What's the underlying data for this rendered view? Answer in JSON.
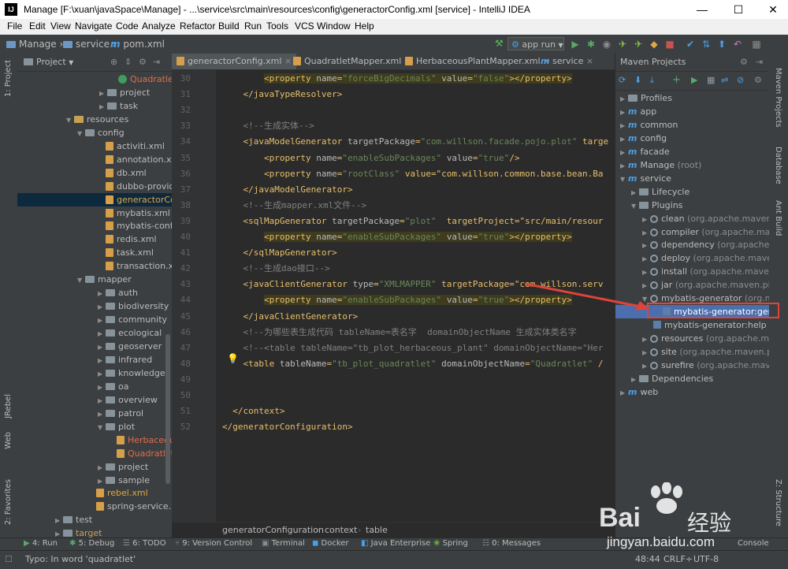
{
  "window": {
    "title": "Manage [F:\\xuan\\javaSpace\\Manage] - ...\\service\\src\\main\\resources\\config\\generactorConfig.xml [service] - IntelliJ IDEA",
    "app_logo": "IJ",
    "minimize": "—",
    "maximize": "☐",
    "close": "✕"
  },
  "menu": [
    "File",
    "Edit",
    "View",
    "Navigate",
    "Code",
    "Analyze",
    "Refactor",
    "Build",
    "Run",
    "Tools",
    "VCS",
    "Window",
    "Help"
  ],
  "breadcrumbs": [
    "Manage",
    "service",
    "pom.xml"
  ],
  "run_config": "app run",
  "left_tools": [
    "1: Project",
    "JRebel",
    "Web",
    "2: Favorites"
  ],
  "project_panel": {
    "title": "Project",
    "rows": [
      {
        "label": "QuadratletM",
        "kind": "class"
      },
      {
        "label": "project",
        "kind": "folder"
      },
      {
        "label": "task",
        "kind": "folder"
      },
      {
        "label": "resources",
        "kind": "folder"
      },
      {
        "label": "config",
        "kind": "folder"
      },
      {
        "label": "activiti.xml",
        "kind": "xml"
      },
      {
        "label": "annotation.xml",
        "kind": "xml"
      },
      {
        "label": "db.xml",
        "kind": "xml"
      },
      {
        "label": "dubbo-provider",
        "kind": "xml"
      },
      {
        "label": "generactorConfi",
        "kind": "xml"
      },
      {
        "label": "mybatis.xml",
        "kind": "xml"
      },
      {
        "label": "mybatis-config.x",
        "kind": "xml"
      },
      {
        "label": "redis.xml",
        "kind": "xml"
      },
      {
        "label": "task.xml",
        "kind": "xml"
      },
      {
        "label": "transaction.xml",
        "kind": "xml"
      },
      {
        "label": "mapper",
        "kind": "folder"
      },
      {
        "label": "auth",
        "kind": "folder"
      },
      {
        "label": "biodiversity",
        "kind": "folder"
      },
      {
        "label": "community",
        "kind": "folder"
      },
      {
        "label": "ecological",
        "kind": "folder"
      },
      {
        "label": "geoserver",
        "kind": "folder"
      },
      {
        "label": "infrared",
        "kind": "folder"
      },
      {
        "label": "knowledge",
        "kind": "folder"
      },
      {
        "label": "oa",
        "kind": "folder"
      },
      {
        "label": "overview",
        "kind": "folder"
      },
      {
        "label": "patrol",
        "kind": "folder"
      },
      {
        "label": "plot",
        "kind": "folder"
      },
      {
        "label": "HerbaceousP",
        "kind": "xml"
      },
      {
        "label": "QuadratletM",
        "kind": "xml"
      },
      {
        "label": "project",
        "kind": "folder"
      },
      {
        "label": "sample",
        "kind": "folder"
      },
      {
        "label": "rebel.xml",
        "kind": "xml"
      },
      {
        "label": "spring-service.xml",
        "kind": "xml"
      },
      {
        "label": "test",
        "kind": "folder"
      },
      {
        "label": "target",
        "kind": "folder"
      }
    ]
  },
  "editor": {
    "tabs": [
      "generactorConfig.xml",
      "QuadratletMapper.xml",
      "HerbaceousPlantMapper.xml",
      "service"
    ],
    "lines": [
      {
        "n": "30",
        "text": "        <property name=\"forceBigDecimals\" value=\"false\"></property>",
        "hl": true
      },
      {
        "n": "31",
        "text": "    </javaTypeResolver>"
      },
      {
        "n": "32",
        "text": ""
      },
      {
        "n": "33",
        "text": "    <!--生成实体-->",
        "comment": true
      },
      {
        "n": "34",
        "text": "    <javaModelGenerator targetPackage=\"com.willson.facade.pojo.plot\" targe"
      },
      {
        "n": "35",
        "text": "        <property name=\"enableSubPackages\" value=\"true\"/>"
      },
      {
        "n": "36",
        "text": "        <property name=\"rootClass\" value=\"com.willson.common.base.bean.Ba"
      },
      {
        "n": "37",
        "text": "    </javaModelGenerator>"
      },
      {
        "n": "38",
        "text": "    <!--生成mapper.xml文件-->",
        "comment": true
      },
      {
        "n": "39",
        "text": "    <sqlMapGenerator targetPackage=\"plot\"  targetProject=\"src/main/resour"
      },
      {
        "n": "40",
        "text": "        <property name=\"enableSubPackages\" value=\"true\"></property>",
        "hl": true
      },
      {
        "n": "41",
        "text": "    </sqlMapGenerator>"
      },
      {
        "n": "42",
        "text": "    <!--生成dao接口-->",
        "comment": true
      },
      {
        "n": "43",
        "text": "    <javaClientGenerator type=\"XMLMAPPER\" targetPackage=\"com.willson.serv"
      },
      {
        "n": "44",
        "text": "        <property name=\"enableSubPackages\" value=\"true\"></property>",
        "hl": true
      },
      {
        "n": "45",
        "text": "    </javaClientGenerator>"
      },
      {
        "n": "46",
        "text": "    <!--为哪些表生成代码 tableName=表名字  domainObjectName 生成实体类名字",
        "comment": true
      },
      {
        "n": "47",
        "text": "    <!--<table tableName=\"tb_plot_herbaceous_plant\" domainObjectName=\"Her",
        "comment": true
      },
      {
        "n": "48",
        "text": "    <table tableName=\"tb_plot_quadratlet\" domainObjectName=\"Quadratlet\" /"
      },
      {
        "n": "49",
        "text": ""
      },
      {
        "n": "50",
        "text": ""
      },
      {
        "n": "51",
        "text": "  </context>"
      },
      {
        "n": "52",
        "text": "</generatorConfiguration>"
      }
    ],
    "crumbs": [
      "generatorConfiguration",
      "context",
      "table"
    ]
  },
  "maven": {
    "title": "Maven Projects",
    "rows": [
      {
        "label": "Profiles",
        "depth": 0,
        "kind": "folder"
      },
      {
        "label": "app",
        "depth": 0,
        "kind": "module"
      },
      {
        "label": "common",
        "depth": 0,
        "kind": "module"
      },
      {
        "label": "config",
        "depth": 0,
        "kind": "module"
      },
      {
        "label": "facade",
        "depth": 0,
        "kind": "module"
      },
      {
        "label": "Manage",
        "suffix": "(root)",
        "depth": 0,
        "kind": "module"
      },
      {
        "label": "service",
        "depth": 0,
        "kind": "module"
      },
      {
        "label": "Lifecycle",
        "depth": 1,
        "kind": "folder"
      },
      {
        "label": "Plugins",
        "depth": 1,
        "kind": "folder"
      },
      {
        "label": "clean",
        "suffix": "(org.apache.maven.plugi",
        "depth": 2,
        "kind": "plugin"
      },
      {
        "label": "compiler",
        "suffix": "(org.apache.maven.",
        "depth": 2,
        "kind": "plugin"
      },
      {
        "label": "dependency",
        "suffix": "(org.apache.mave",
        "depth": 2,
        "kind": "plugin"
      },
      {
        "label": "deploy",
        "suffix": "(org.apache.maven.pl",
        "depth": 2,
        "kind": "plugin"
      },
      {
        "label": "install",
        "suffix": "(org.apache.maven.pl",
        "depth": 2,
        "kind": "plugin"
      },
      {
        "label": "jar",
        "suffix": "(org.apache.maven.plugin",
        "depth": 2,
        "kind": "plugin"
      },
      {
        "label": "mybatis-generator",
        "suffix": "(org.myba",
        "depth": 2,
        "kind": "plugin"
      },
      {
        "label": "mybatis-generator:generate",
        "depth": 3,
        "kind": "goal",
        "selected": true
      },
      {
        "label": "mybatis-generator:help",
        "depth": 3,
        "kind": "goal"
      },
      {
        "label": "resources",
        "suffix": "(org.apache.maven",
        "depth": 2,
        "kind": "plugin"
      },
      {
        "label": "site",
        "suffix": "(org.apache.maven.plugi",
        "depth": 2,
        "kind": "plugin"
      },
      {
        "label": "surefire",
        "suffix": "(org.apache.maven.p",
        "depth": 2,
        "kind": "plugin"
      },
      {
        "label": "Dependencies",
        "depth": 1,
        "kind": "folder"
      },
      {
        "label": "web",
        "depth": 0,
        "kind": "module"
      }
    ]
  },
  "right_tools": [
    "Maven Projects",
    "Database",
    "Ant Build",
    "Z: Structure"
  ],
  "bottom_tools": [
    "4: Run",
    "5: Debug",
    "6: TODO",
    "9: Version Control",
    "Terminal",
    "Docker",
    "Java Enterprise",
    "Spring",
    "0: Messages",
    "Console"
  ],
  "status": {
    "message": "Typo: In word 'quadratlet'",
    "position": "48:44",
    "line_sep": "CRLF÷",
    "encoding": "UTF-8"
  },
  "watermark": {
    "brand": "Bai",
    "brand2": "经验",
    "url": "jingyan.baidu.com"
  },
  "colors": {
    "selection": "#4b6eaf",
    "arrow": "#e0433a",
    "highlight_box": "#e0433a"
  }
}
